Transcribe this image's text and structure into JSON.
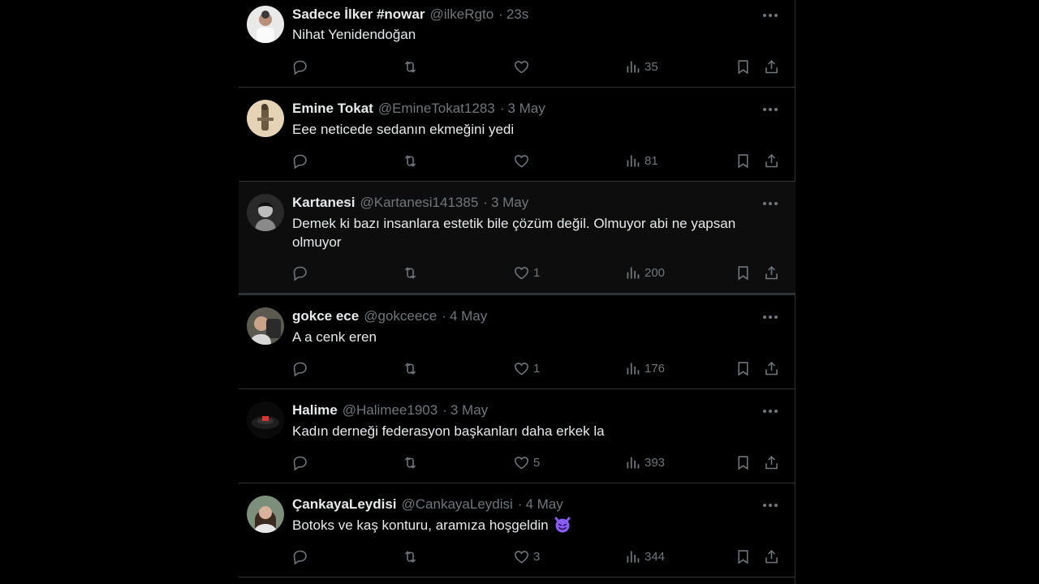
{
  "tweets": [
    {
      "name": "Sadece İlker #nowar",
      "handle": "@ilkeRgto",
      "time": "23s",
      "text": "Nihat Yenidendoğan",
      "likes": "",
      "views": "35",
      "avatar": "avatar-man-white-shirt"
    },
    {
      "name": "Emine Tokat",
      "handle": "@EmineTokat1283",
      "time": "3 May",
      "text": "Eee neticede sedanın ekmeğini yedi",
      "likes": "",
      "views": "81",
      "avatar": "avatar-figure-beige"
    },
    {
      "name": "Kartanesi",
      "handle": "@Kartanesi141385",
      "time": "3 May",
      "text": "Demek ki bazı insanlara estetik bile çözüm değil. Olmuyor abi ne yapsan olmuyor",
      "likes": "1",
      "views": "200",
      "avatar": "avatar-dark-portrait"
    },
    {
      "name": "gokce ece",
      "handle": "@gokceece",
      "time": "4 May",
      "text": "A a cenk eren",
      "likes": "1",
      "views": "176",
      "avatar": "avatar-photo"
    },
    {
      "name": "Halime",
      "handle": "@Halimee1903",
      "time": "3 May",
      "text": "Kadın derneği federasyon başkanları daha erkek la",
      "likes": "5",
      "views": "393",
      "avatar": "avatar-stadium"
    },
    {
      "name": "ÇankayaLeydisi",
      "handle": "@CankayaLeydisi",
      "time": "4 May",
      "text": "Botoks ve kaş konturu, aramıza hoşgeldin",
      "emoji": "smiling-devil-emoji",
      "likes": "3",
      "views": "344",
      "avatar": "avatar-woman"
    }
  ],
  "icons": {
    "reply": "reply-icon",
    "retweet": "retweet-icon",
    "like": "heart-icon",
    "views": "views-chart-icon",
    "bookmark": "bookmark-icon",
    "share": "share-icon",
    "more": "more-dots-icon"
  },
  "colors": {
    "background": "#000000",
    "text": "#e7e9ea",
    "muted": "#71767b",
    "border": "#2f3336",
    "emoji": "#8b5cf6"
  }
}
